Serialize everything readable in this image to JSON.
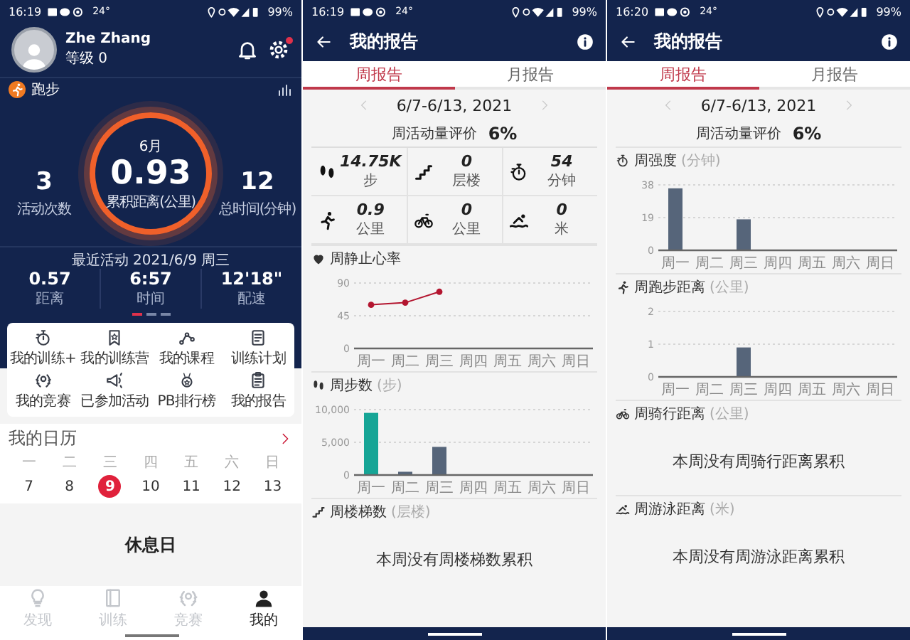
{
  "screens": [
    {
      "kind": "profile",
      "status_bar": {
        "time": "16:19",
        "temperature": "24°",
        "battery": "99%"
      },
      "user": {
        "name": "Zhe Zhang",
        "level": "等级 0",
        "notification_dot": true
      },
      "sport": "跑步",
      "ring": {
        "month": "6月",
        "value": "0.93",
        "label": "累积距离(公里)"
      },
      "side_stats": [
        {
          "value": "3",
          "label": "活动次数"
        },
        {
          "value": "12",
          "label": "总时间(分钟)"
        }
      ],
      "recent": {
        "title": "最近活动 2021/6/9 周三",
        "stats": [
          {
            "value": "0.57",
            "label": "距离"
          },
          {
            "value": "6:57",
            "label": "时间"
          },
          {
            "value": "12'18\"",
            "label": "配速"
          }
        ]
      },
      "pager": [
        {
          "selected": true
        },
        {
          "selected": false
        },
        {
          "selected": false
        }
      ],
      "shortcuts": [
        {
          "kind": "training",
          "label": "我的训练+"
        },
        {
          "kind": "camp",
          "label": "我的训练营"
        },
        {
          "kind": "course",
          "label": "我的课程"
        },
        {
          "kind": "plan",
          "label": "训练计划"
        },
        {
          "kind": "race",
          "label": "我的竞赛"
        },
        {
          "kind": "events",
          "label": "已参加活动"
        },
        {
          "kind": "ranking",
          "label": "PB排行榜"
        },
        {
          "kind": "report",
          "label": "我的报告"
        }
      ],
      "calendar": {
        "title": "我的日历",
        "days": [
          {
            "weekday": "一",
            "date": "7",
            "selected": false
          },
          {
            "weekday": "二",
            "date": "8",
            "selected": false
          },
          {
            "weekday": "三",
            "date": "9",
            "selected": true
          },
          {
            "weekday": "四",
            "date": "10",
            "selected": false
          },
          {
            "weekday": "五",
            "date": "11",
            "selected": false
          },
          {
            "weekday": "六",
            "date": "12",
            "selected": false
          },
          {
            "weekday": "日",
            "date": "13",
            "selected": false
          }
        ]
      },
      "rest_day": "休息日",
      "nav": [
        {
          "kind": "discover",
          "label": "发现",
          "selected": false
        },
        {
          "kind": "training",
          "label": "训练",
          "selected": false
        },
        {
          "kind": "race",
          "label": "竞赛",
          "selected": false
        },
        {
          "kind": "me",
          "label": "我的",
          "selected": true
        }
      ]
    },
    {
      "kind": "report",
      "status_bar": {
        "time": "16:19",
        "temperature": "24°",
        "battery": "99%"
      },
      "title": "我的报告",
      "tabs": [
        {
          "label": "周报告",
          "selected": true
        },
        {
          "label": "月报告",
          "selected": false
        }
      ],
      "date_range": "6/7-6/13, 2021",
      "score": {
        "label": "周活动量评价",
        "value": "6%"
      },
      "stats": [
        {
          "kind": "steps",
          "value": "14.75K",
          "unit": "步"
        },
        {
          "kind": "floors",
          "value": "0",
          "unit": "层楼"
        },
        {
          "kind": "intensity",
          "value": "54",
          "unit": "分钟"
        },
        {
          "kind": "run",
          "value": "0.9",
          "unit": "公里"
        },
        {
          "kind": "bike",
          "value": "0",
          "unit": "公里"
        },
        {
          "kind": "swim",
          "value": "0",
          "unit": "米"
        }
      ],
      "sections": [
        {
          "kind": "heart_rate",
          "title": "周静止心率",
          "chart_data": {
            "type": "line",
            "categories": [
              "周一",
              "周二",
              "周三",
              "周四",
              "周五",
              "周六",
              "周日"
            ],
            "series": [
              {
                "color": "#b3152f",
                "marker": "circle",
                "values": [
                  60,
                  63,
                  78,
                  null,
                  null,
                  null,
                  null
                ]
              }
            ],
            "ylim": [
              0,
              90
            ],
            "yticks": [
              0,
              45,
              90
            ]
          }
        },
        {
          "kind": "steps",
          "title": "周步数",
          "unit": "(步)",
          "chart_data": {
            "type": "bar",
            "categories": [
              "周一",
              "周二",
              "周三",
              "周四",
              "周五",
              "周六",
              "周日"
            ],
            "series": [
              {
                "color": "#16a596",
                "values": [
                  9500,
                  null,
                  null,
                  null,
                  null,
                  null,
                  null
                ]
              },
              {
                "color": "#56657a",
                "values": [
                  null,
                  500,
                  4300,
                  0,
                  0,
                  0,
                  0
                ]
              }
            ],
            "ylim": [
              0,
              10000
            ],
            "yticks": [
              0,
              {
                "value": 5000,
                "label": "5,000"
              },
              {
                "value": 10000,
                "label": "10,000"
              }
            ]
          }
        },
        {
          "kind": "floors",
          "title": "周楼梯数",
          "unit": "(层楼)",
          "message": "本周没有周楼梯数累积"
        }
      ]
    },
    {
      "kind": "report",
      "status_bar": {
        "time": "16:20",
        "temperature": "24°",
        "battery": "99%"
      },
      "title": "我的报告",
      "tabs": [
        {
          "label": "周报告",
          "selected": true
        },
        {
          "label": "月报告",
          "selected": false
        }
      ],
      "date_range": "6/7-6/13, 2021",
      "score": {
        "label": "周活动量评价",
        "value": "6%"
      },
      "sections": [
        {
          "kind": "intensity",
          "title": "周强度",
          "unit": "(分钟)",
          "chart_data": {
            "type": "bar",
            "categories": [
              "周一",
              "周二",
              "周三",
              "周四",
              "周五",
              "周六",
              "周日"
            ],
            "series": [
              {
                "color": "#56657a",
                "values": [
                  36,
                  0,
                  18,
                  0,
                  0,
                  0,
                  0
                ]
              }
            ],
            "ylim": [
              0,
              38
            ],
            "yticks": [
              0,
              19,
              38
            ]
          }
        },
        {
          "kind": "run",
          "title": "周跑步距离",
          "unit": "(公里)",
          "chart_data": {
            "type": "bar",
            "categories": [
              "周一",
              "周二",
              "周三",
              "周四",
              "周五",
              "周六",
              "周日"
            ],
            "series": [
              {
                "color": "#56657a",
                "values": [
                  0,
                  0,
                  0.9,
                  0,
                  0,
                  0,
                  0
                ]
              }
            ],
            "ylim": [
              0,
              2
            ],
            "yticks": [
              0,
              1,
              2
            ]
          }
        },
        {
          "kind": "bike",
          "title": "周骑行距离",
          "unit": "(公里)",
          "message": "本周没有周骑行距离累积"
        },
        {
          "kind": "swim",
          "title": "周游泳距离",
          "unit": "(米)",
          "message": "本周没有周游泳距离累积"
        }
      ]
    }
  ]
}
